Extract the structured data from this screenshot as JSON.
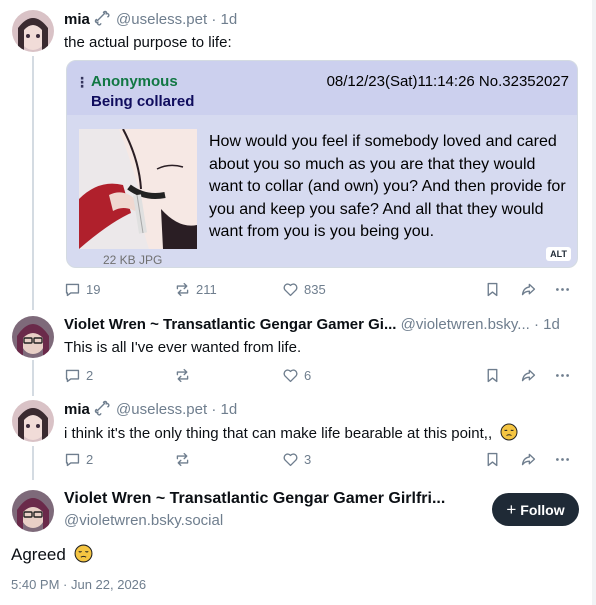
{
  "posts": [
    {
      "name": "mia",
      "handle": "@useless.pet",
      "sep": "·",
      "time": "1d",
      "text": "the actual purpose to life:",
      "counts": {
        "replies": "19",
        "reposts": "211",
        "likes": "835"
      },
      "embed": {
        "poster": "Anonymous",
        "subject": "Being collared",
        "date_no": "08/12/23(Sat)11:14:26 No.32352027",
        "file_info": "22 KB JPG",
        "quote": "How would you feel if somebody loved and cared about you so much as you are that they would want to collar (and own) you? And then provide for you and keep you safe? And all that they would want from you is you being you.",
        "alt_badge": "ALT"
      }
    },
    {
      "name": "Violet Wren ~ Transatlantic Gengar Gamer Gi...",
      "handle": "@violetwren.bsky...",
      "sep": "·",
      "time": "1d",
      "text": "This is all I've ever wanted from life.",
      "counts": {
        "replies": "2",
        "reposts": "",
        "likes": "6"
      }
    },
    {
      "name": "mia",
      "handle": "@useless.pet",
      "sep": "·",
      "time": "1d",
      "text": "i think it's the only thing that can make life bearable at this point,,",
      "counts": {
        "replies": "2",
        "reposts": "",
        "likes": "3"
      }
    }
  ],
  "focused": {
    "name": "Violet Wren ~ Transatlantic Gengar Gamer Girlfri...",
    "handle": "@violetwren.bsky.social",
    "follow_label": "Follow",
    "text": "Agreed",
    "timestamp": "5:40 PM · Jun 22, 2026"
  },
  "icons": [
    "reply-icon",
    "repost-icon",
    "like-icon",
    "bookmark-icon",
    "share-icon",
    "more-icon",
    "bone-icon",
    "pensive-emoji",
    "plus-icon"
  ],
  "colors": {
    "muted": "#6f7e8e",
    "text": "#0b0f14",
    "follow_bg": "#1f2a36",
    "chan_green": "#117743",
    "chan_blue": "#0f0c5d",
    "chan_bg": "#d6daf0"
  }
}
